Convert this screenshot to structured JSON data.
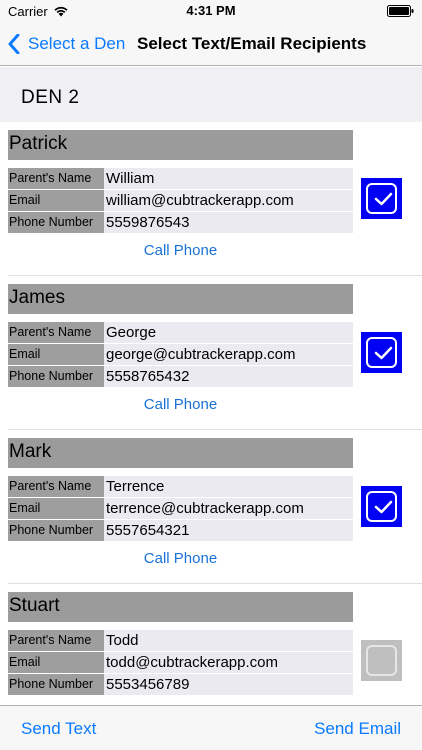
{
  "status_bar": {
    "carrier": "Carrier",
    "time": "4:31 PM"
  },
  "nav": {
    "back_label": "Select a Den",
    "title": "Select Text/Email Recipients"
  },
  "section": {
    "title": "DEN 2"
  },
  "labels": {
    "parent": "Parent's Name",
    "email": "Email",
    "phone": "Phone Number"
  },
  "scouts": [
    {
      "name": "Patrick",
      "parent": "William",
      "email": "william@cubtrackerapp.com",
      "phone": "5559876543",
      "call_label": "Call Phone",
      "selected": true
    },
    {
      "name": "James",
      "parent": "George",
      "email": "george@cubtrackerapp.com",
      "phone": "5558765432",
      "call_label": "Call Phone",
      "selected": true
    },
    {
      "name": "Mark",
      "parent": "Terrence",
      "email": "terrence@cubtrackerapp.com",
      "phone": "5557654321",
      "call_label": "Call Phone",
      "selected": true
    },
    {
      "name": "Stuart",
      "parent": "Todd",
      "email": "todd@cubtrackerapp.com",
      "phone": "5553456789",
      "selected": false
    }
  ],
  "toolbar": {
    "send_text": "Send Text",
    "send_email": "Send Email"
  },
  "colors": {
    "accent": "#0a7aff",
    "checkbox_on": "#0000f5",
    "checkbox_off": "#bfbfbf",
    "name_bar": "#9b9b9b"
  }
}
